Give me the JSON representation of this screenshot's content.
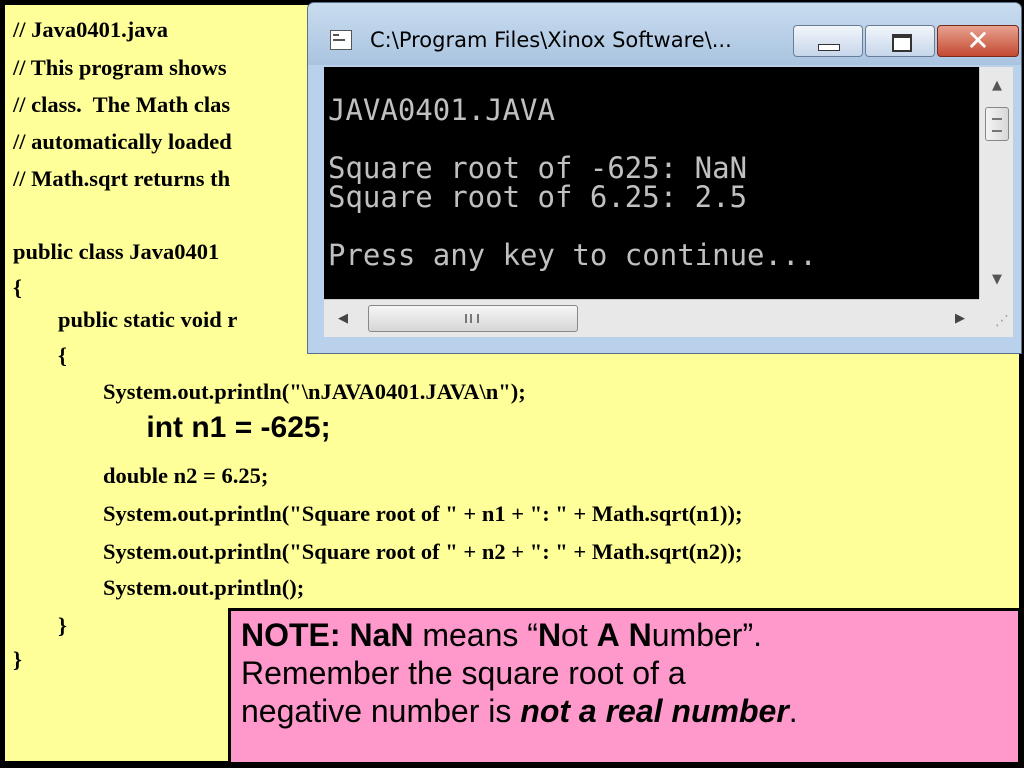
{
  "code": {
    "lines": [
      "// Java0401.java",
      "// This program shows",
      "// class.  The Math clas",
      "// automatically loaded",
      "// Math.sqrt returns th",
      "",
      "public class Java0401",
      "{",
      "        public static void r",
      "        {",
      "                System.out.println(\"\\nJAVA0401.JAVA\\n\");",
      "                int n1 = -625;",
      "                double n2 = 6.25;",
      "                System.out.println(\"Square root of \" + n1 + \": \" + Math.sqrt(n1));",
      "                System.out.println(\"Square root of \" + n2 + \": \" + Math.sqrt(n2));",
      "                System.out.println();",
      "        }",
      "}"
    ]
  },
  "window": {
    "title": "C:\\Program Files\\Xinox Software\\...",
    "close_symbol": "✕",
    "console_lines": [
      "JAVA0401.JAVA",
      "Square root of -625: NaN",
      "Square root of 6.25: 2.5",
      "Press any key to continue..."
    ],
    "scroll_up_symbol": "▲",
    "scroll_down_symbol": "▼",
    "scroll_left_symbol": "◀",
    "scroll_right_symbol": "▶"
  },
  "note": {
    "line1_prefix": "NOTE:  NaN",
    "line1_means": " means “",
    "line1_n1": "N",
    "line1_ot": "ot ",
    "line1_a": "A",
    "line1_space": " ",
    "line1_n2": "N",
    "line1_umber": "umber”.",
    "line2": "Remember the square root of a",
    "line3_prefix": "negative number is ",
    "line3_emph": "not a real number",
    "line3_suffix": "."
  }
}
